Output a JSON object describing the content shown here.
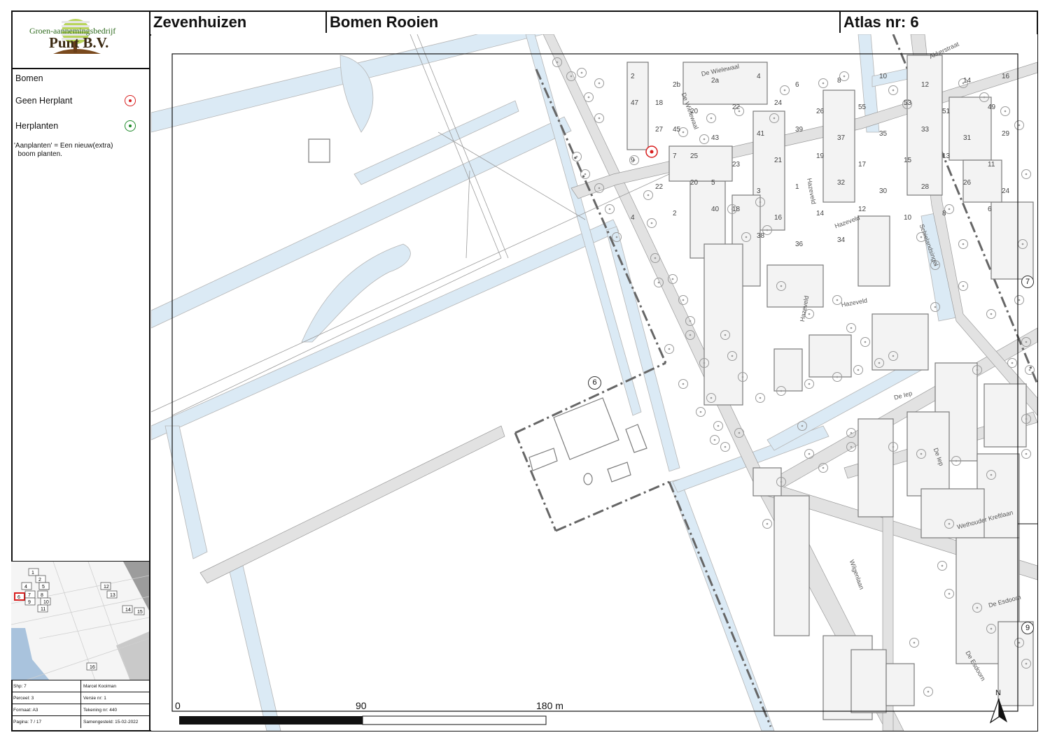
{
  "header": {
    "place": "Zevenhuizen",
    "subject": "Bomen Rooien",
    "atlas": "Atlas nr: 6"
  },
  "logo": {
    "company": "Groen-aannemingsbedrijf",
    "name": "Punt B.V."
  },
  "legend": {
    "title": "Bomen",
    "items": [
      {
        "label": "Geen Herplant",
        "color": "#d81e1e"
      },
      {
        "label": "Herplanten",
        "color": "#1e8a2a"
      }
    ],
    "note": "'Aanplanten' = Een nieuw(extra)\n  boom planten."
  },
  "overview": {
    "sheets": [
      "1",
      "2",
      "3",
      "4",
      "5",
      "6",
      "7",
      "8",
      "9",
      "10",
      "11",
      "12",
      "13",
      "14",
      "15",
      "16"
    ],
    "current": "6"
  },
  "info": {
    "cells": [
      "Shp: 7",
      "Marcel Kooiman",
      "Perceel: 3",
      "Versie nr: 1",
      "Formaat: A3",
      "Tekening nr: 440",
      "Pagina: 7 / 17",
      "Samengesteld: 15-02-2022"
    ]
  },
  "map": {
    "scale_labels": [
      "0",
      "90",
      "180 m"
    ],
    "parcel_marker": "6",
    "adjacent_sheets": [
      "7",
      "9"
    ],
    "north": "N",
    "streets": [
      "De Wielewaal",
      "De Wielewaal",
      "Akkerstraat",
      "Hazeveld",
      "Hazeveld",
      "Hazeveld",
      "Hazeveld",
      "Schielandsingel",
      "De Iep",
      "De Iep",
      "Wilgenlaan",
      "Wethouder Kreftlaan",
      "De Esdoorn",
      "De Esdoorn"
    ],
    "building_numbers": [
      "2",
      "2b",
      "2a",
      "4",
      "6",
      "8",
      "10",
      "12",
      "14",
      "16",
      "18",
      "20",
      "22",
      "24",
      "26",
      "55",
      "53",
      "51",
      "49",
      "47",
      "45",
      "43",
      "41",
      "39",
      "37",
      "35",
      "33",
      "31",
      "29",
      "27",
      "25",
      "23",
      "21",
      "19",
      "17",
      "15",
      "13",
      "11",
      "9",
      "7",
      "5",
      "3",
      "1",
      "32",
      "30",
      "28",
      "26",
      "24",
      "22",
      "20",
      "18",
      "16",
      "14",
      "12",
      "10",
      "8",
      "6",
      "4",
      "2",
      "40",
      "38",
      "36",
      "34"
    ],
    "tree_removal_color": "#d81e1e"
  }
}
